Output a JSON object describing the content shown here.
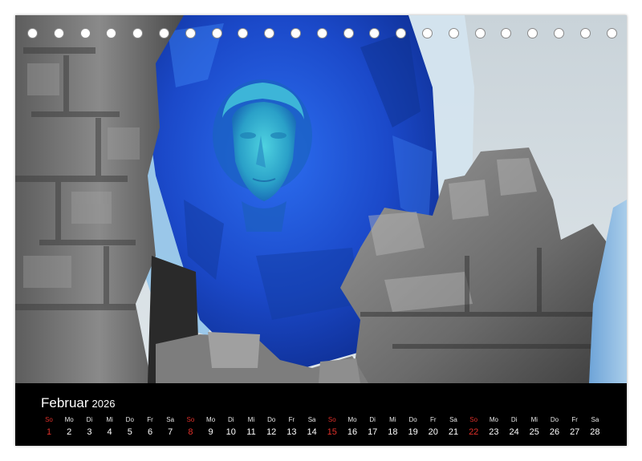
{
  "calendar": {
    "month": "Februar",
    "year": "2026",
    "days": [
      {
        "wd": "So",
        "num": "1",
        "sun": true
      },
      {
        "wd": "Mo",
        "num": "2"
      },
      {
        "wd": "Di",
        "num": "3"
      },
      {
        "wd": "Mi",
        "num": "4"
      },
      {
        "wd": "Do",
        "num": "5"
      },
      {
        "wd": "Fr",
        "num": "6"
      },
      {
        "wd": "Sa",
        "num": "7"
      },
      {
        "wd": "So",
        "num": "8",
        "sun": true
      },
      {
        "wd": "Mo",
        "num": "9"
      },
      {
        "wd": "Di",
        "num": "10"
      },
      {
        "wd": "Mi",
        "num": "11"
      },
      {
        "wd": "Do",
        "num": "12"
      },
      {
        "wd": "Fr",
        "num": "13"
      },
      {
        "wd": "Sa",
        "num": "14"
      },
      {
        "wd": "So",
        "num": "15",
        "sun": true
      },
      {
        "wd": "Mo",
        "num": "16"
      },
      {
        "wd": "Di",
        "num": "17"
      },
      {
        "wd": "Mi",
        "num": "18"
      },
      {
        "wd": "Do",
        "num": "19"
      },
      {
        "wd": "Fr",
        "num": "20"
      },
      {
        "wd": "Sa",
        "num": "21"
      },
      {
        "wd": "So",
        "num": "22",
        "sun": true
      },
      {
        "wd": "Mo",
        "num": "23"
      },
      {
        "wd": "Di",
        "num": "24"
      },
      {
        "wd": "Mi",
        "num": "25"
      },
      {
        "wd": "Do",
        "num": "26"
      },
      {
        "wd": "Fr",
        "num": "27"
      },
      {
        "wd": "Sa",
        "num": "28"
      }
    ]
  },
  "colors": {
    "sunday": "#e0302a",
    "glass_blue": "#1f4fd6",
    "stone_gray": "#6e6e6e",
    "background": "#000000"
  }
}
